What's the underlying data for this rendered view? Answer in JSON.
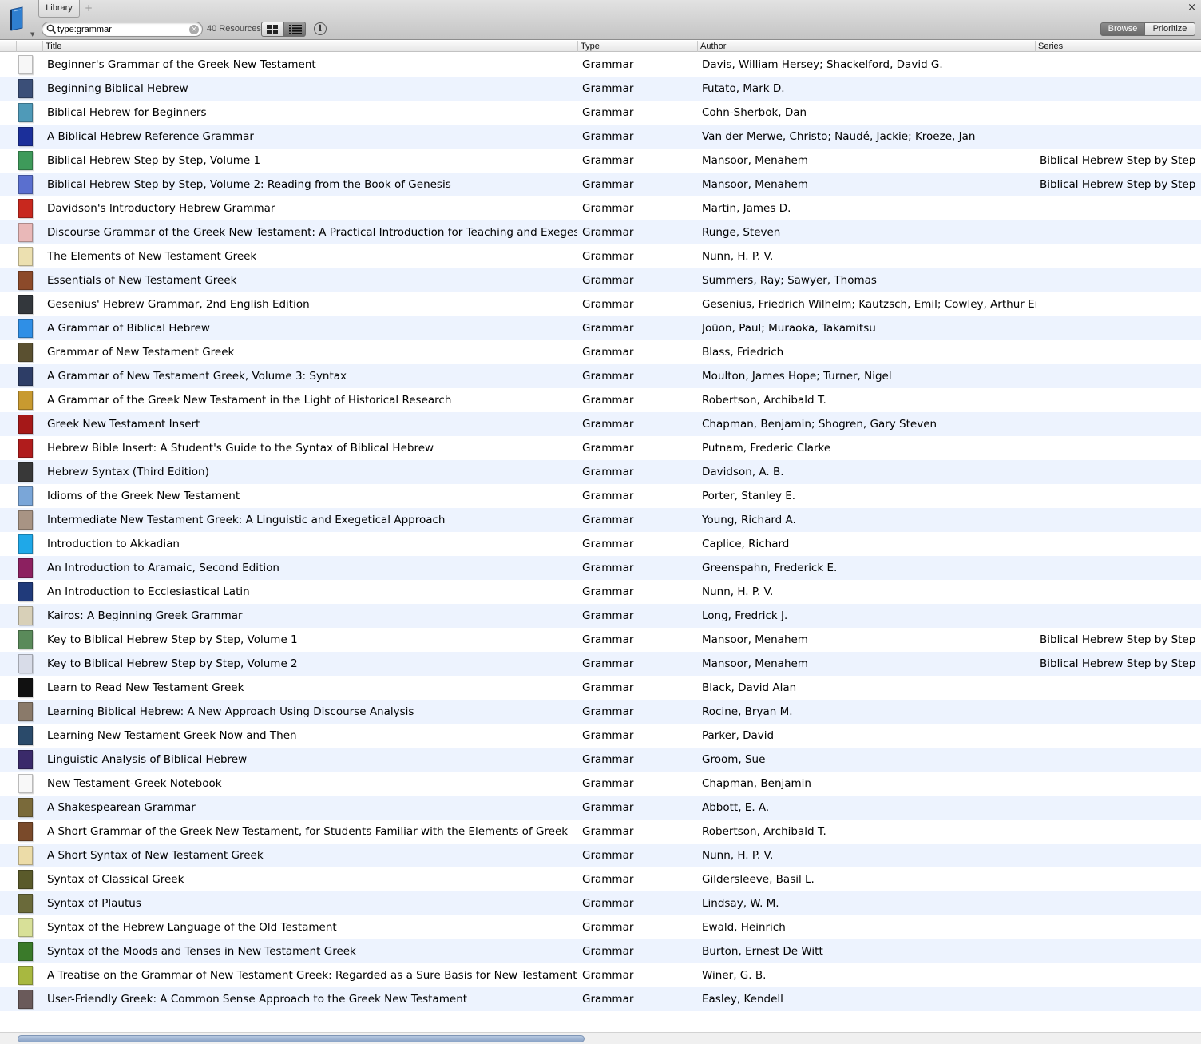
{
  "window": {
    "tab_label": "Library",
    "tab_add": "+",
    "close": "×"
  },
  "toolbar": {
    "search_value": "type:grammar",
    "clear_glyph": "×",
    "resource_count": "40 Resources",
    "info_glyph": "i",
    "browse_label": "Browse",
    "prioritize_label": "Prioritize"
  },
  "columns": {
    "title": "Title",
    "type": "Type",
    "author": "Author",
    "series": "Series"
  },
  "rows": [
    {
      "title": "Beginner's Grammar of the Greek New Testament",
      "type": "Grammar",
      "author": "Davis, William Hersey; Shackelford, David G.",
      "series": "",
      "cover": "#f7f7f7"
    },
    {
      "title": "Beginning Biblical Hebrew",
      "type": "Grammar",
      "author": "Futato, Mark D.",
      "series": "",
      "cover": "#3b4f78"
    },
    {
      "title": "Biblical Hebrew for Beginners",
      "type": "Grammar",
      "author": "Cohn-Sherbok, Dan",
      "series": "",
      "cover": "#4f9ab8"
    },
    {
      "title": "A Biblical Hebrew Reference Grammar",
      "type": "Grammar",
      "author": "Van der Merwe, Christo; Naudé, Jackie; Kroeze, Jan",
      "series": "",
      "cover": "#1b2f9a"
    },
    {
      "title": "Biblical Hebrew Step by Step, Volume 1",
      "type": "Grammar",
      "author": "Mansoor, Menahem",
      "series": "Biblical Hebrew Step by Step",
      "cover": "#3e9a5a"
    },
    {
      "title": "Biblical Hebrew Step by Step, Volume 2: Reading from the Book of Genesis",
      "type": "Grammar",
      "author": "Mansoor, Menahem",
      "series": "Biblical Hebrew Step by Step",
      "cover": "#5a6fcf"
    },
    {
      "title": "Davidson's Introductory Hebrew Grammar",
      "type": "Grammar",
      "author": "Martin, James D.",
      "series": "",
      "cover": "#c8281e"
    },
    {
      "title": "Discourse Grammar of the Greek New Testament: A Practical Introduction for Teaching and Exegesis",
      "type": "Grammar",
      "author": "Runge, Steven",
      "series": "",
      "cover": "#e9b8b8"
    },
    {
      "title": "The Elements of New Testament Greek",
      "type": "Grammar",
      "author": "Nunn, H. P. V.",
      "series": "",
      "cover": "#ece0b0"
    },
    {
      "title": "Essentials of New Testament Greek",
      "type": "Grammar",
      "author": "Summers, Ray; Sawyer, Thomas",
      "series": "",
      "cover": "#8c4a2a"
    },
    {
      "title": "Gesenius' Hebrew Grammar, 2nd English Edition",
      "type": "Grammar",
      "author": "Gesenius, Friedrich Wilhelm; Kautzsch, Emil; Cowley, Arthur Ernest",
      "series": "",
      "cover": "#33373c"
    },
    {
      "title": "A Grammar of Biblical Hebrew",
      "type": "Grammar",
      "author": "Joüon, Paul; Muraoka, Takamitsu",
      "series": "",
      "cover": "#2f8fe6"
    },
    {
      "title": "Grammar of New Testament Greek",
      "type": "Grammar",
      "author": "Blass, Friedrich",
      "series": "",
      "cover": "#5a5030"
    },
    {
      "title": "A Grammar of New Testament Greek, Volume 3: Syntax",
      "type": "Grammar",
      "author": "Moulton, James Hope; Turner, Nigel",
      "series": "",
      "cover": "#2d3d66"
    },
    {
      "title": "A Grammar of the Greek New Testament in the Light of Historical Research",
      "type": "Grammar",
      "author": "Robertson, Archibald T.",
      "series": "",
      "cover": "#c89a30"
    },
    {
      "title": "Greek New Testament Insert",
      "type": "Grammar",
      "author": "Chapman, Benjamin; Shogren, Gary Steven",
      "series": "",
      "cover": "#a51818"
    },
    {
      "title": "Hebrew Bible Insert: A Student's Guide to the Syntax of Biblical Hebrew",
      "type": "Grammar",
      "author": "Putnam, Frederic Clarke",
      "series": "",
      "cover": "#b01c1c"
    },
    {
      "title": "Hebrew Syntax (Third Edition)",
      "type": "Grammar",
      "author": "Davidson, A. B.",
      "series": "",
      "cover": "#383838"
    },
    {
      "title": "Idioms of the Greek New Testament",
      "type": "Grammar",
      "author": "Porter, Stanley E.",
      "series": "",
      "cover": "#7aa6d8"
    },
    {
      "title": "Intermediate New Testament Greek: A Linguistic and Exegetical Approach",
      "type": "Grammar",
      "author": "Young, Richard A.",
      "series": "",
      "cover": "#a89484"
    },
    {
      "title": "Introduction to Akkadian",
      "type": "Grammar",
      "author": "Caplice, Richard",
      "series": "",
      "cover": "#1fa8e8"
    },
    {
      "title": "An Introduction to Aramaic, Second Edition",
      "type": "Grammar",
      "author": "Greenspahn, Frederick E.",
      "series": "",
      "cover": "#8c2060"
    },
    {
      "title": "An Introduction to Ecclesiastical Latin",
      "type": "Grammar",
      "author": "Nunn, H. P. V.",
      "series": "",
      "cover": "#203a7a"
    },
    {
      "title": "Kairos: A Beginning Greek Grammar",
      "type": "Grammar",
      "author": "Long, Fredrick J.",
      "series": "",
      "cover": "#d8d0b8"
    },
    {
      "title": "Key to Biblical Hebrew Step by Step, Volume 1",
      "type": "Grammar",
      "author": "Mansoor, Menahem",
      "series": "Biblical Hebrew Step by Step",
      "cover": "#5a8a5a"
    },
    {
      "title": "Key to Biblical Hebrew Step by Step, Volume 2",
      "type": "Grammar",
      "author": "Mansoor, Menahem",
      "series": "Biblical Hebrew Step by Step",
      "cover": "#d8dce8"
    },
    {
      "title": "Learn to Read New Testament Greek",
      "type": "Grammar",
      "author": "Black, David Alan",
      "series": "",
      "cover": "#111111"
    },
    {
      "title": "Learning Biblical Hebrew: A New Approach Using Discourse Analysis",
      "type": "Grammar",
      "author": "Rocine, Bryan M.",
      "series": "",
      "cover": "#8a7a6a"
    },
    {
      "title": "Learning New Testament Greek Now and Then",
      "type": "Grammar",
      "author": "Parker, David",
      "series": "",
      "cover": "#2a4a6a"
    },
    {
      "title": "Linguistic Analysis of Biblical Hebrew",
      "type": "Grammar",
      "author": "Groom, Sue",
      "series": "",
      "cover": "#3a2a6a"
    },
    {
      "title": "New Testament-Greek Notebook",
      "type": "Grammar",
      "author": "Chapman, Benjamin",
      "series": "",
      "cover": "#f8f8f8"
    },
    {
      "title": "A Shakespearean Grammar",
      "type": "Grammar",
      "author": "Abbott, E. A.",
      "series": "",
      "cover": "#7a6a3a"
    },
    {
      "title": "A Short Grammar of the Greek New Testament, for Students Familiar with the Elements of Greek",
      "type": "Grammar",
      "author": "Robertson, Archibald T.",
      "series": "",
      "cover": "#7a4a2a"
    },
    {
      "title": "A Short Syntax of New Testament Greek",
      "type": "Grammar",
      "author": "Nunn, H. P. V.",
      "series": "",
      "cover": "#ecdca8"
    },
    {
      "title": "Syntax of Classical Greek",
      "type": "Grammar",
      "author": "Gildersleeve, Basil L.",
      "series": "",
      "cover": "#5a5a2a"
    },
    {
      "title": "Syntax of Plautus",
      "type": "Grammar",
      "author": "Lindsay, W. M.",
      "series": "",
      "cover": "#6a6a3a"
    },
    {
      "title": "Syntax of the Hebrew Language of the Old Testament",
      "type": "Grammar",
      "author": "Ewald, Heinrich",
      "series": "",
      "cover": "#d8e098"
    },
    {
      "title": "Syntax of the Moods and Tenses in New Testament Greek",
      "type": "Grammar",
      "author": "Burton, Ernest De Witt",
      "series": "",
      "cover": "#3a7a2a"
    },
    {
      "title": "A Treatise on the Grammar of New Testament Greek: Regarded as a Sure Basis for New Testament Exegesis",
      "type": "Grammar",
      "author": "Winer, G. B.",
      "series": "",
      "cover": "#a8b840"
    },
    {
      "title": "User-Friendly Greek: A Common Sense Approach to the Greek New Testament",
      "type": "Grammar",
      "author": "Easley, Kendell",
      "series": "",
      "cover": "#6a5a5a"
    }
  ]
}
